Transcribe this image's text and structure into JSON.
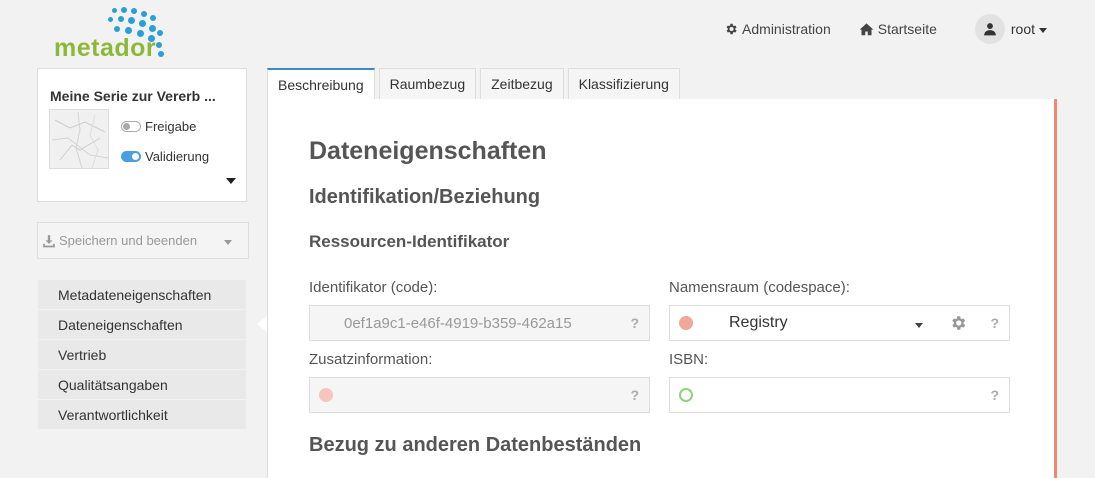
{
  "logo": {
    "text": "metador"
  },
  "nav": {
    "admin_label": "Administration",
    "home_label": "Startseite",
    "user_label": "root"
  },
  "series": {
    "title": "Meine Serie zur Vererb ...",
    "freigabe_label": "Freigabe",
    "freigabe_on": false,
    "validierung_label": "Validierung",
    "validierung_on": true
  },
  "save": {
    "label": "Speichern und beenden"
  },
  "menu": {
    "items": [
      {
        "label": "Metadateneigenschaften"
      },
      {
        "label": "Dateneigenschaften"
      },
      {
        "label": "Vertrieb"
      },
      {
        "label": "Qualitätsangaben"
      },
      {
        "label": "Verantwortlichkeit"
      }
    ],
    "active_index": 1
  },
  "tabs": [
    {
      "label": "Beschreibung"
    },
    {
      "label": "Raumbezug"
    },
    {
      "label": "Zeitbezug"
    },
    {
      "label": "Klassifizierung"
    }
  ],
  "content": {
    "title": "Dateneigenschaften",
    "section": "Identifikation/Beziehung",
    "subsection": "Ressourcen-Identifikator",
    "identifier_label": "Identifikator (code):",
    "identifier_value": "0ef1a9c1-e46f-4919-b359-462a15",
    "namespace_label": "Namensraum (codespace):",
    "namespace_value": "Registry",
    "additional_label": "Zusatzinformation:",
    "isbn_label": "ISBN:",
    "help_glyph": "?",
    "bottom_section": "Bezug zu anderen Datenbeständen"
  },
  "colors": {
    "accent": "#2a9fd6",
    "logo_green": "#8cb83a",
    "panel_edge": "#ee8a6e",
    "required_red": "#f0a899",
    "ok_green": "#8ed47c"
  }
}
